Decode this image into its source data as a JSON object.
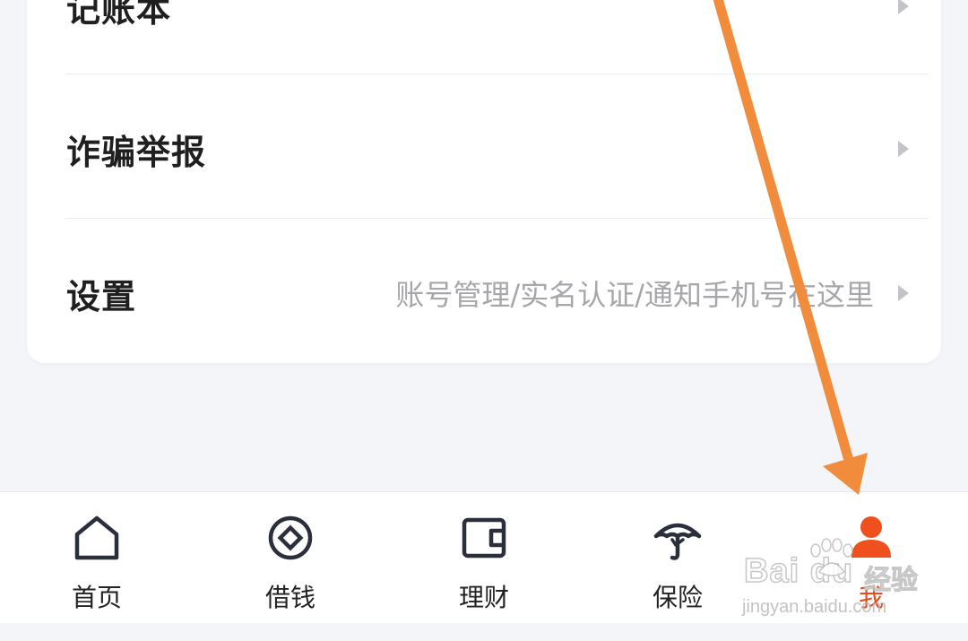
{
  "menu": {
    "items": [
      {
        "label": "记账本",
        "sub": ""
      },
      {
        "label": "诈骗举报",
        "sub": ""
      },
      {
        "label": "设置",
        "sub": "账号管理/实名认证/通知手机号在这里"
      }
    ]
  },
  "tabbar": {
    "tabs": [
      {
        "label": "首页",
        "icon": "home-icon"
      },
      {
        "label": "借钱",
        "icon": "coin-icon"
      },
      {
        "label": "理财",
        "icon": "wallet-icon"
      },
      {
        "label": "保险",
        "icon": "umbrella-icon"
      },
      {
        "label": "我",
        "icon": "person-icon"
      }
    ],
    "active_index": 4
  },
  "annotation": {
    "color": "#f08c3c",
    "target": "tab-me"
  },
  "watermark": {
    "brand": "Bai  du",
    "site_label": "经验",
    "url": "jingyan.baidu.com"
  },
  "colors": {
    "accent": "#e84a1d",
    "background": "#f4f5f9",
    "text_primary": "#1f1f1f",
    "text_secondary": "#a6a6ab"
  }
}
